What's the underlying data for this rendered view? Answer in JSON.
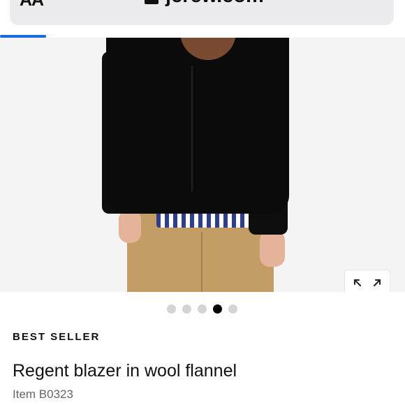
{
  "browser": {
    "reader_label": "AA",
    "url": "jcrew.com",
    "lock_icon": "lock-icon",
    "reload_icon": "reload-icon",
    "accent_color": "#1a66e6"
  },
  "gallery": {
    "image_alt": "Model wearing black blazer, back view",
    "expand_icon": "expand-icon",
    "dots": [
      {
        "active": false
      },
      {
        "active": false
      },
      {
        "active": false
      },
      {
        "active": true
      },
      {
        "active": false
      }
    ]
  },
  "product": {
    "badge": "BEST SELLER",
    "title": "Regent blazer in wool flannel",
    "item_number": "Item B0323"
  }
}
